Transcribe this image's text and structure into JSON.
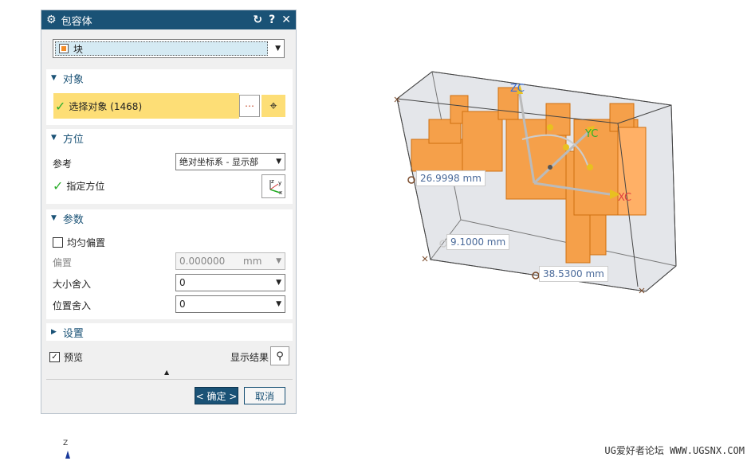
{
  "dialog": {
    "title": "包容体",
    "type_select": "块",
    "sections": {
      "object": {
        "label": "对象",
        "select_label": "选择对象 (1468)"
      },
      "orientation": {
        "label": "方位",
        "reference_label": "参考",
        "reference_value": "绝对坐标系 - 显示部",
        "specify_label": "指定方位"
      },
      "params": {
        "label": "参数",
        "uniform_offset": "均匀偏置",
        "offset_label": "偏置",
        "offset_value": "0.000000",
        "offset_unit": "mm",
        "size_round_label": "大小舍入",
        "size_round_value": "0",
        "pos_round_label": "位置舍入",
        "pos_round_value": "0"
      },
      "settings": {
        "label": "设置"
      }
    },
    "preview_label": "预览",
    "show_result_label": "显示结果",
    "ok_label": "< 确定 >",
    "cancel_label": "取消"
  },
  "viewport": {
    "dims": [
      "26.9998 mm",
      "9.1000 mm",
      "38.5300 mm"
    ],
    "axes": {
      "z": "ZC",
      "y": "YC",
      "x": "XC"
    },
    "triad_z": "Z"
  },
  "watermark": "UG爱好者论坛 WWW.UGSNX.COM",
  "colors": {
    "accent": "#1a5276",
    "select_bg": "#fdde76",
    "part": "#f5a04a"
  }
}
